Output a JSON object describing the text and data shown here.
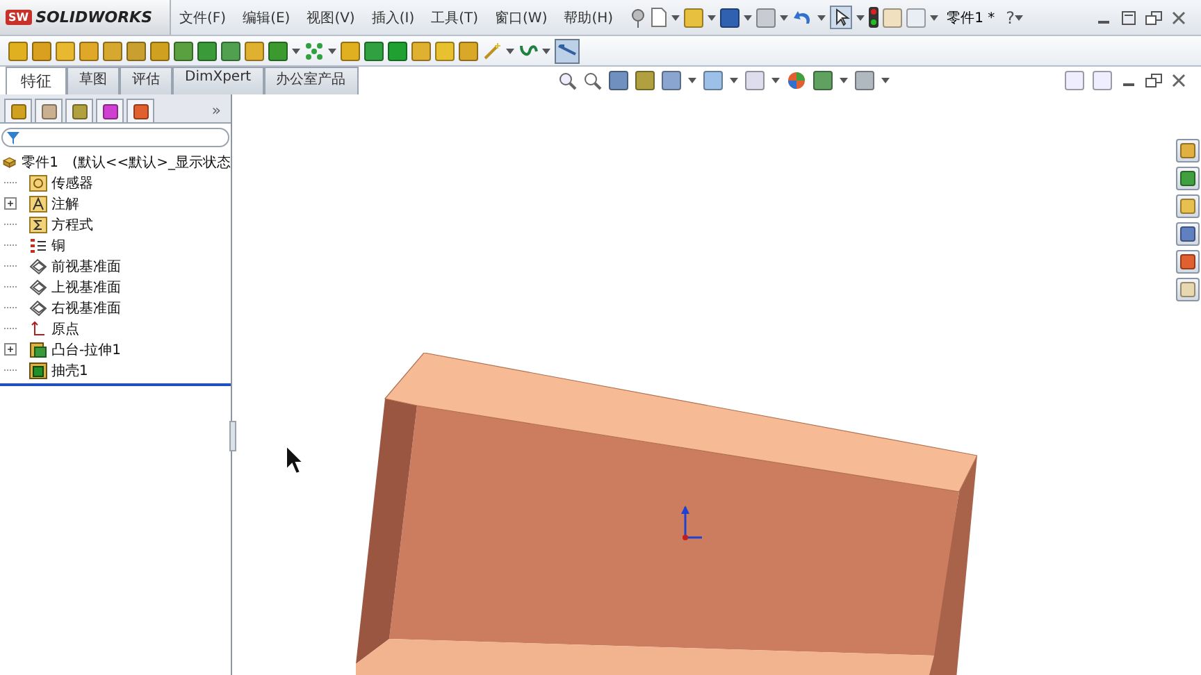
{
  "app": {
    "logo_badge": "SW",
    "logo": "SOLIDWORKS"
  },
  "menu": [
    {
      "label": "文件(F)"
    },
    {
      "label": "编辑(E)"
    },
    {
      "label": "视图(V)"
    },
    {
      "label": "插入(I)"
    },
    {
      "label": "工具(T)"
    },
    {
      "label": "窗口(W)"
    },
    {
      "label": "帮助(H)"
    }
  ],
  "document_title": "零件1 *",
  "help": "?",
  "tabs": [
    {
      "label": "特征",
      "selected": true
    },
    {
      "label": "草图",
      "selected": false
    },
    {
      "label": "评估",
      "selected": false
    },
    {
      "label": "DimXpert",
      "selected": false
    },
    {
      "label": "办公室产品",
      "selected": false
    }
  ],
  "panel_more": "»",
  "tree": {
    "root": {
      "label": "零件1",
      "config": "(默认<<默认>_显示状态"
    },
    "items": [
      {
        "label": "传感器",
        "kind": "sensor"
      },
      {
        "label": "注解",
        "kind": "annotation",
        "expanded": false
      },
      {
        "label": "方程式",
        "kind": "equation"
      },
      {
        "label": "铜",
        "kind": "material"
      },
      {
        "label": "前视基准面",
        "kind": "plane"
      },
      {
        "label": "上视基准面",
        "kind": "plane"
      },
      {
        "label": "右视基准面",
        "kind": "plane"
      },
      {
        "label": "原点",
        "kind": "origin"
      },
      {
        "label": "凸台-拉伸1",
        "kind": "extrude",
        "expanded": false
      },
      {
        "label": "抽壳1",
        "kind": "shell"
      }
    ]
  }
}
